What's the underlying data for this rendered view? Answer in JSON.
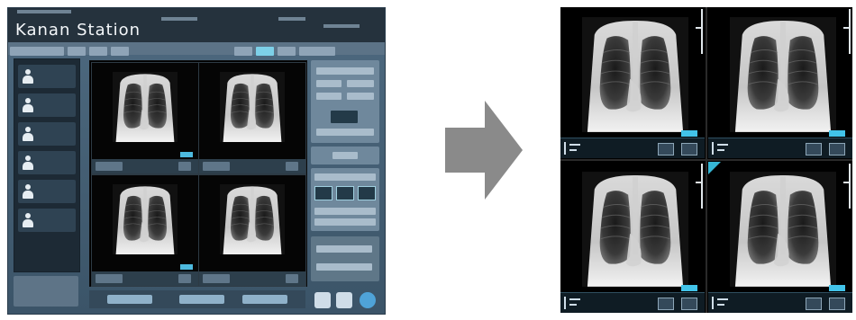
{
  "console": {
    "title": "Kanan Station",
    "sidebar_items": [
      "",
      "",
      "",
      "",
      "",
      ""
    ],
    "colors": {
      "background": "#4e6a80",
      "header": "#25323d",
      "accent": "#4dbadf",
      "highlight_tab": "#7dd0e8"
    }
  },
  "arrow": {
    "color": "#8a8a8a",
    "icon": "right-arrow-icon"
  },
  "viewer": {
    "layout": "2x2",
    "cells": [
      {
        "position": "top-left",
        "selected": false
      },
      {
        "position": "top-right",
        "selected": false
      },
      {
        "position": "bottom-left",
        "selected": false
      },
      {
        "position": "bottom-right",
        "selected": true
      }
    ],
    "colors": {
      "marker": "#36b7d6",
      "tag": "#42c3e9"
    }
  }
}
